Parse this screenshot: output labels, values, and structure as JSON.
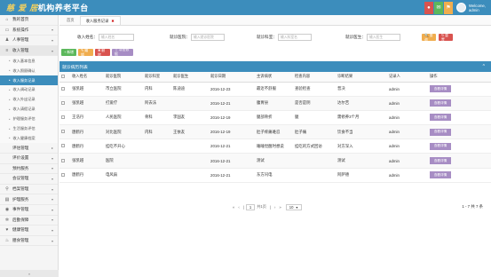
{
  "header": {
    "title_hi": "慈 爱 居",
    "title_rest": "机构养老平台",
    "welcome": "Welcome,",
    "username": "admin",
    "badge_colors": [
      "#d9534f",
      "#5cb85c",
      "#f0ad4e"
    ]
  },
  "sidebar": {
    "items": [
      {
        "label": "我的首页",
        "icon": "home-icon",
        "glyph": "⌂"
      },
      {
        "label": "系统操作",
        "icon": "desktop-icon",
        "glyph": "▭",
        "chev": "▾"
      },
      {
        "label": "人事管理",
        "icon": "user-icon",
        "glyph": "♟",
        "chev": "▾"
      },
      {
        "label": "收入管理",
        "icon": "list-icon",
        "glyph": "≡",
        "chev": "▾",
        "open": true
      }
    ],
    "subitems": [
      {
        "label": "收入基本信息"
      },
      {
        "label": "收入照顾确认"
      },
      {
        "label": "收入服务记录",
        "active": true
      },
      {
        "label": "收入调动记录"
      },
      {
        "label": "收入外出记录"
      },
      {
        "label": "收入请假记录"
      },
      {
        "label": "护理服务评估"
      },
      {
        "label": "生活服务评估"
      },
      {
        "label": "收入健康档案"
      }
    ],
    "items2": [
      {
        "label": "评估管理",
        "chev": "▸"
      },
      {
        "label": "评价设置",
        "chev": "▾"
      },
      {
        "label": "预约服务",
        "chev": "▾"
      },
      {
        "label": "会议管理",
        "chev": "▾"
      },
      {
        "label": "档案管理",
        "icon": "key-icon",
        "glyph": "⚲",
        "chev": "▾"
      },
      {
        "label": "护理服务",
        "icon": "card-icon",
        "glyph": "▤",
        "chev": "▾"
      },
      {
        "label": "事件管理",
        "icon": "bulb-icon",
        "glyph": "◉",
        "chev": "▾"
      },
      {
        "label": "后勤保障",
        "icon": "gear-icon",
        "glyph": "✲",
        "chev": "▾"
      },
      {
        "label": "健康管理",
        "icon": "heart-icon",
        "glyph": "♥",
        "chev": "▾"
      },
      {
        "label": "膳食管理",
        "icon": "food-icon",
        "glyph": "♨",
        "chev": "▾"
      }
    ],
    "bottom": "«"
  },
  "tabs": [
    {
      "label": "首页"
    },
    {
      "label": "收入服务记录",
      "close": "✖",
      "active": true
    }
  ],
  "filters": {
    "f1_label": "收入姓名：",
    "f1_placeholder": "输入姓名",
    "f2_label": "就诊医院：",
    "f2_placeholder": "输入就诊医院",
    "f3_label": "就诊科室：",
    "f3_placeholder": "输入科室名",
    "f4_label": "就诊医生：",
    "f4_placeholder": "输入医生",
    "search": "🔍 查询",
    "reset": "↻ 重置"
  },
  "actions": [
    "+ 新增",
    "✎ 编辑",
    "✖ 删除",
    "⇧ 导出数据"
  ],
  "panel": {
    "title": "就诊病历列表",
    "collapse": "^",
    "columns": [
      "",
      "收入姓名",
      "就诊医院",
      "就诊科室",
      "就诊医生",
      "就诊日期",
      "主诉病状",
      "检查内容",
      "诊断结果",
      "记录人",
      "操作"
    ],
    "rows": [
      [
        "张凯越",
        "市立医院",
        "内科",
        "陈迪迪",
        "2016-12-23",
        "最近不舒服",
        "查验检查",
        "普决",
        "admin",
        "查看详情"
      ],
      [
        "张凯越",
        "打爱疗",
        "阿去法",
        "",
        "2016-12-21",
        "腹胃县",
        "是否是阴",
        "达尔苦",
        "admin",
        "查看详情"
      ],
      [
        "王浩丹",
        "人民医院",
        "骨科",
        "李国友",
        "2016-12-19",
        "腿部骨折",
        "腿",
        "需修养3个月",
        "admin",
        "查看详情"
      ],
      [
        "唐鹤丹",
        "对比医院",
        "内科",
        "王依友",
        "2016-12-19",
        "肚子疼痛难忍",
        "肚子痛",
        "饮食不当",
        "admin",
        "查看详情"
      ],
      [
        "唐鹤丹",
        "挂吃不开心",
        "",
        "",
        "2016-12-21",
        "睡睡觉醒时想说",
        "挂吃的方式回访",
        "对方深入",
        "admin",
        "查看详情"
      ],
      [
        "张凯越",
        "医院",
        "",
        "",
        "2016-12-21",
        "测试",
        "",
        "测试",
        "admin",
        "查看详情"
      ],
      [
        "唐鹤丹",
        "电风扇",
        "",
        "",
        "2016-12-21",
        "东方闪电",
        "",
        "阿萨德",
        "admin",
        "查看详情"
      ]
    ]
  },
  "pager": {
    "first": "«",
    "prev": "‹",
    "page": "1",
    "of": "共1页",
    "next": "›",
    "last": "»",
    "size": "10",
    "count": "1 - 7 共 7 条"
  }
}
